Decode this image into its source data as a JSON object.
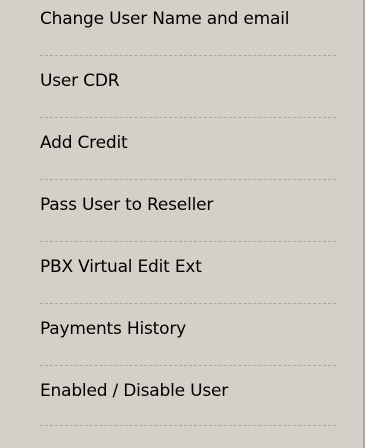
{
  "menu": {
    "items": [
      {
        "label": "Change User Name and email"
      },
      {
        "label": "User CDR"
      },
      {
        "label": "Add Credit"
      },
      {
        "label": "Pass User to Reseller"
      },
      {
        "label": "PBX Virtual Edit Ext"
      },
      {
        "label": "Payments History"
      },
      {
        "label": "Enabled / Disable User"
      }
    ]
  }
}
